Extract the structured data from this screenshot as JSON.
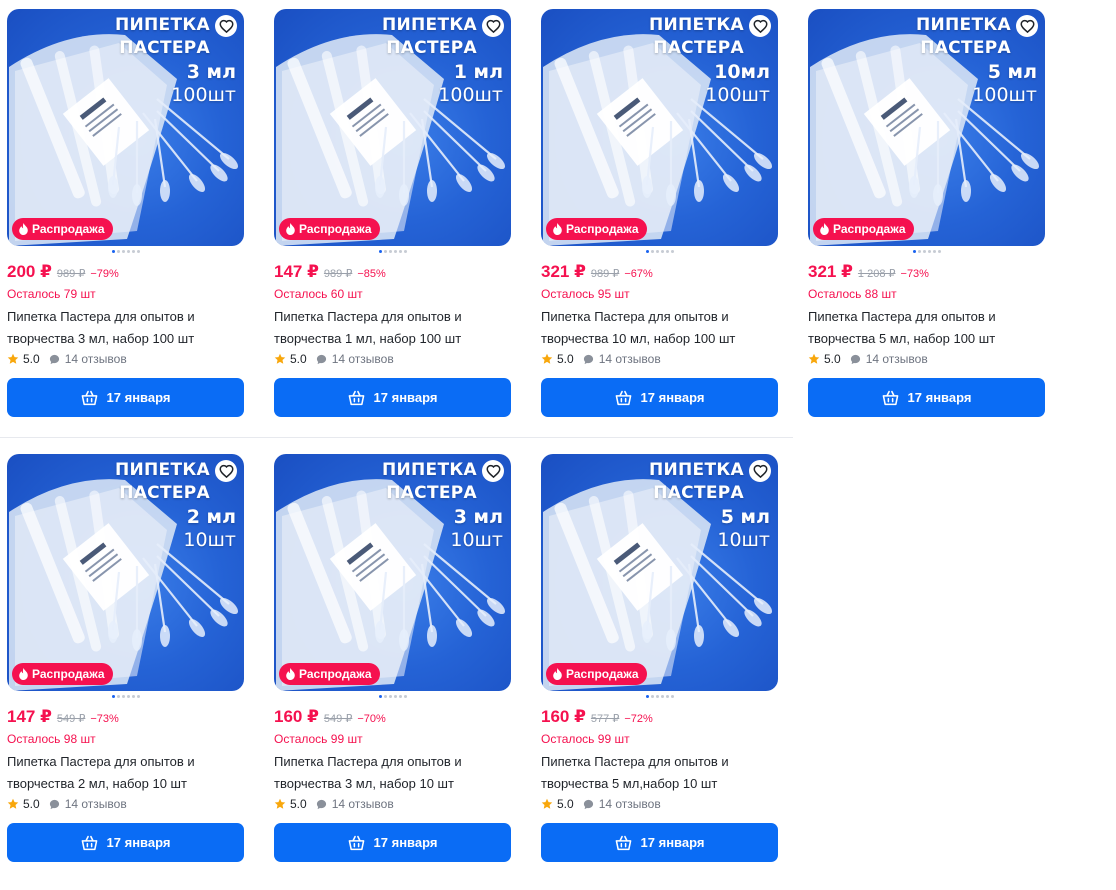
{
  "products": [
    {
      "image": {
        "title": "ПИПЕТКА\nПАСТЕРА",
        "volume": "3 мл",
        "count": "100шт"
      },
      "badge": "Распродажа",
      "price": "200 ₽",
      "old_price": "989 ₽",
      "discount": "−79%",
      "stock": "Осталось 79 шт",
      "title": "Пипетка Пастера для опытов и творчества 3 мл, набор 100 шт",
      "rating": "5.0",
      "reviews": "14 отзывов",
      "delivery": "17 января",
      "image_slides": 6,
      "active_slide": 0
    },
    {
      "image": {
        "title": "ПИПЕТКА\nПАСТЕРА",
        "volume": "1 мл",
        "count": "100шт"
      },
      "badge": "Распродажа",
      "price": "147 ₽",
      "old_price": "989 ₽",
      "discount": "−85%",
      "stock": "Осталось 60 шт",
      "title": "Пипетка Пастера для опытов и творчества 1 мл, набор 100 шт",
      "rating": "5.0",
      "reviews": "14 отзывов",
      "delivery": "17 января",
      "image_slides": 6,
      "active_slide": 0
    },
    {
      "image": {
        "title": "ПИПЕТКА\nПАСТЕРА",
        "volume": "10мл",
        "count": "100шт"
      },
      "badge": "Распродажа",
      "price": "321 ₽",
      "old_price": "989 ₽",
      "discount": "−67%",
      "stock": "Осталось 95 шт",
      "title": "Пипетка Пастера для опытов и творчества 10 мл, набор 100 шт",
      "rating": "5.0",
      "reviews": "14 отзывов",
      "delivery": "17 января",
      "image_slides": 6,
      "active_slide": 0
    },
    {
      "image": {
        "title": "ПИПЕТКА\nПАСТЕРА",
        "volume": "5 мл",
        "count": "100шт"
      },
      "badge": "Распродажа",
      "price": "321 ₽",
      "old_price": "1 208 ₽",
      "discount": "−73%",
      "stock": "Осталось 88 шт",
      "title": "Пипетка Пастера для опытов и творчества 5 мл, набор 100 шт",
      "rating": "5.0",
      "reviews": "14 отзывов",
      "delivery": "17 января",
      "image_slides": 6,
      "active_slide": 0
    },
    {
      "image": {
        "title": "ПИПЕТКА\nПАСТЕРА",
        "volume": "2 мл",
        "count": "10шт"
      },
      "badge": "Распродажа",
      "price": "147 ₽",
      "old_price": "549 ₽",
      "discount": "−73%",
      "stock": "Осталось 98 шт",
      "title": "Пипетка Пастера для опытов и творчества 2 мл, набор 10 шт",
      "rating": "5.0",
      "reviews": "14 отзывов",
      "delivery": "17 января",
      "image_slides": 6,
      "active_slide": 0
    },
    {
      "image": {
        "title": "ПИПЕТКА\nПАСТЕРА",
        "volume": "3 мл",
        "count": "10шт"
      },
      "badge": "Распродажа",
      "price": "160 ₽",
      "old_price": "549 ₽",
      "discount": "−70%",
      "stock": "Осталось 99 шт",
      "title": "Пипетка Пастера для опытов и творчества 3 мл, набор 10 шт",
      "rating": "5.0",
      "reviews": "14 отзывов",
      "delivery": "17 января",
      "image_slides": 6,
      "active_slide": 0
    },
    {
      "image": {
        "title": "ПИПЕТКА\nПАСТЕРА",
        "volume": "5 мл",
        "count": "10шт"
      },
      "badge": "Распродажа",
      "price": "160 ₽",
      "old_price": "577 ₽",
      "discount": "−72%",
      "stock": "Осталось 99 шт",
      "title": "Пипетка Пастера для опытов и творчества 5 мл,набор 10 шт",
      "rating": "5.0",
      "reviews": "14 отзывов",
      "delivery": "17 января",
      "image_slides": 6,
      "active_slide": 0
    }
  ],
  "colors": {
    "price": "#f5114f",
    "button": "#0a6cf5",
    "image_bg": "#2563d6",
    "star": "#f8a70c",
    "slide_dot_active": "#1a63f0"
  },
  "icons": {
    "favorite": "heart-icon",
    "badge": "fire-icon",
    "rating": "star-icon",
    "reviews": "chat-bubble-icon",
    "button": "basket-icon"
  }
}
